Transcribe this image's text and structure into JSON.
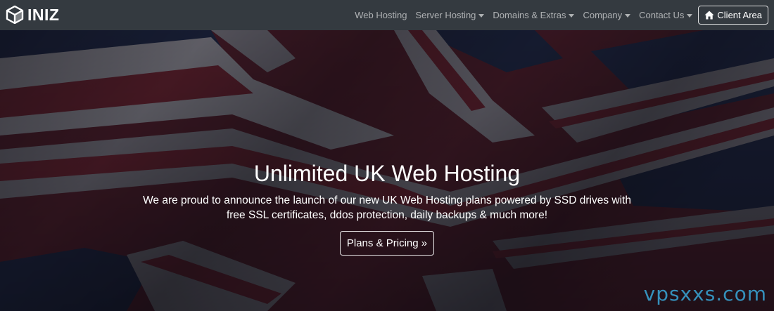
{
  "brand": {
    "name": "INIZ",
    "icon": "cube-logo-icon"
  },
  "nav": {
    "items": [
      {
        "label": "Web Hosting",
        "dropdown": false
      },
      {
        "label": "Server Hosting",
        "dropdown": true
      },
      {
        "label": "Domains & Extras",
        "dropdown": true
      },
      {
        "label": "Company",
        "dropdown": true
      },
      {
        "label": "Contact Us",
        "dropdown": true
      }
    ],
    "client_area": {
      "label": "Client Area",
      "icon": "home-icon"
    }
  },
  "hero": {
    "title": "Unlimited UK Web Hosting",
    "subtitle": "We are proud to announce the launch of our new UK Web Hosting plans powered by SSD drives with free SSL certificates, ddos protection, daily backups & much more!",
    "button_label": "Plans & Pricing »",
    "background": "union-jack-flag"
  },
  "watermark": "vpsxxs.com",
  "colors": {
    "navbar": "#343a40",
    "nav_text": "#9a9da0",
    "flag_red": "#6e1f28",
    "flag_blue": "#1d2a48",
    "watermark": "#39a7d8"
  }
}
